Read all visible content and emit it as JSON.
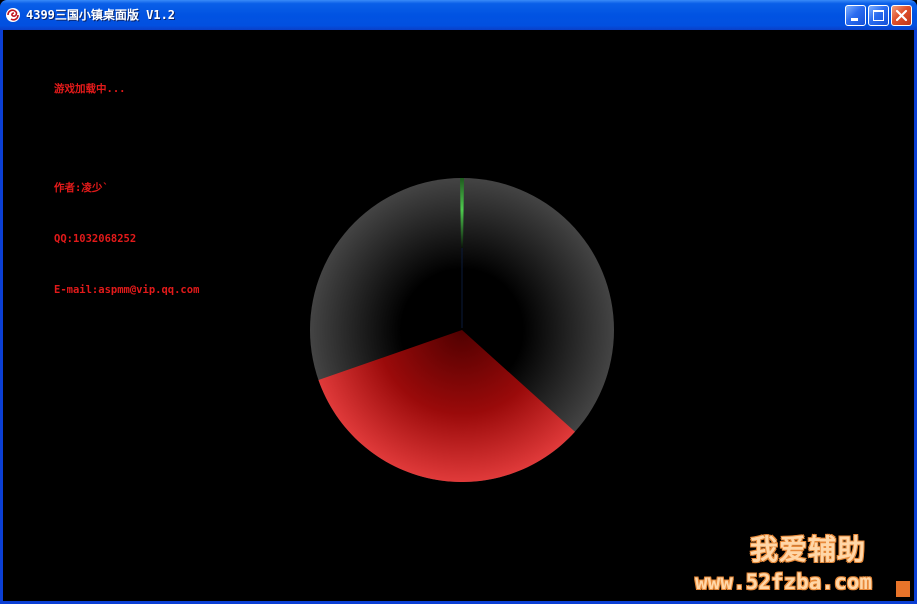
{
  "window": {
    "title": "4399三国小镇桌面版 V1.2",
    "icon": "red-swirl-app-icon",
    "buttons": [
      "minimize",
      "maximize",
      "close"
    ]
  },
  "content": {
    "loading_text": "游戏加载中...",
    "author": "作者:凌少`",
    "qq": "QQ:1032068252",
    "email": "E-mail:aspmm@vip.qq.com"
  },
  "loader": {
    "progress": 0.33,
    "fill_color": "#e02a2a",
    "track_color": "#3a3a3a",
    "hand_color": "#3fbf3f"
  },
  "watermark": {
    "brand": "我爱辅助",
    "url": "www.52fzba.com"
  },
  "colors": {
    "text_accent": "#e21a1a",
    "titlebar": "#0153e2"
  }
}
